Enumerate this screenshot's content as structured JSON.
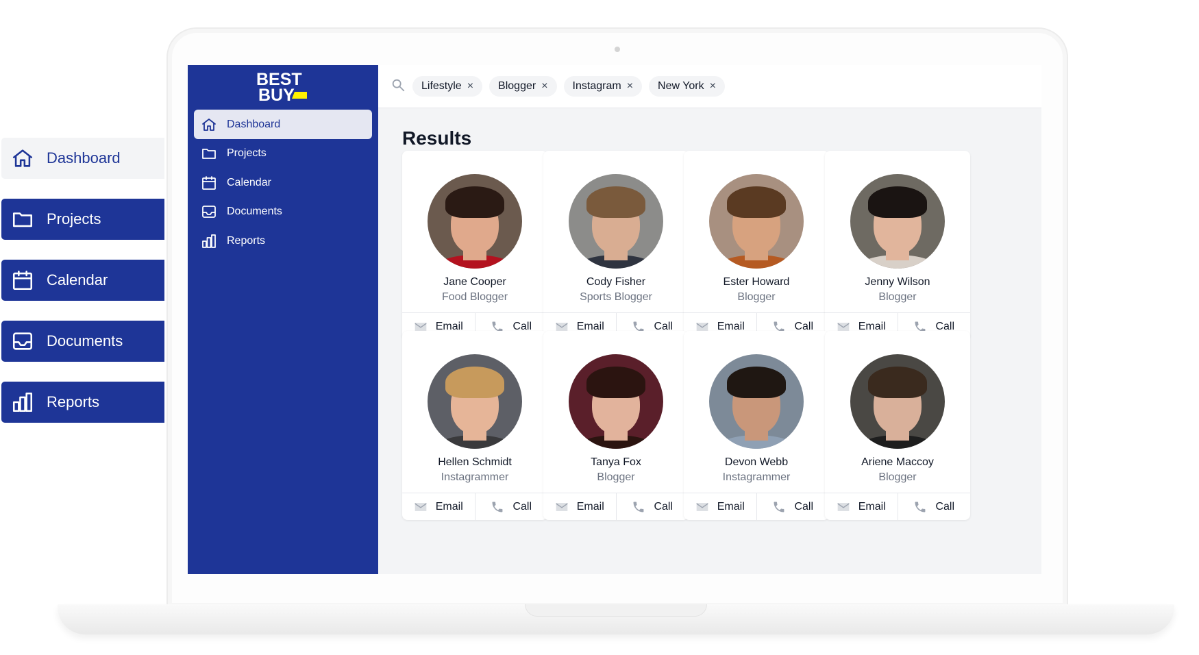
{
  "float_nav": [
    {
      "label": "Dashboard",
      "icon": "home-icon",
      "active": true
    },
    {
      "label": "Projects",
      "icon": "folder-icon",
      "active": false
    },
    {
      "label": "Calendar",
      "icon": "calendar-icon",
      "active": false
    },
    {
      "label": "Documents",
      "icon": "inbox-icon",
      "active": false
    },
    {
      "label": "Reports",
      "icon": "chart-bar-icon",
      "active": false
    }
  ],
  "brand": {
    "line1": "BEST",
    "line2": "BUY",
    "primary_color": "#1e3597",
    "tag_color": "#fff200"
  },
  "sidebar": {
    "items": [
      {
        "label": "Dashboard",
        "icon": "home-icon",
        "active": true
      },
      {
        "label": "Projects",
        "icon": "folder-icon",
        "active": false
      },
      {
        "label": "Calendar",
        "icon": "calendar-icon",
        "active": false
      },
      {
        "label": "Documents",
        "icon": "inbox-icon",
        "active": false
      },
      {
        "label": "Reports",
        "icon": "chart-bar-icon",
        "active": false
      }
    ]
  },
  "search": {
    "icon": "search-icon",
    "chips": [
      {
        "label": "Lifestyle",
        "remove": "×"
      },
      {
        "label": "Blogger",
        "remove": "×"
      },
      {
        "label": "Instagram",
        "remove": "×"
      },
      {
        "label": "New York",
        "remove": "×"
      }
    ]
  },
  "results": {
    "title": "Results",
    "email_label": "Email",
    "call_label": "Call",
    "people": [
      {
        "name": "Jane Cooper",
        "role": "Food Blogger",
        "bg": "#6b5a4e",
        "skin": "#e0a98c",
        "hair": "#2a1a14",
        "shirt": "#b3121f"
      },
      {
        "name": "Cody Fisher",
        "role": "Sports Blogger",
        "bg": "#8c8c8a",
        "skin": "#d9ad92",
        "hair": "#7a5a3c",
        "shirt": "#2f3440"
      },
      {
        "name": "Ester Howard",
        "role": "Blogger",
        "bg": "#a89080",
        "skin": "#d7a27f",
        "hair": "#5a3a22",
        "shirt": "#b55a22"
      },
      {
        "name": "Jenny Wilson",
        "role": "Blogger",
        "bg": "#6e6a62",
        "skin": "#e1b59c",
        "hair": "#1a1412",
        "shirt": "#d8d0c8"
      },
      {
        "name": "Hellen Schmidt",
        "role": "Instagrammer",
        "bg": "#5d5f66",
        "skin": "#e6b598",
        "hair": "#c79a5c",
        "shirt": "#3a3a3c"
      },
      {
        "name": "Tanya Fox",
        "role": "Blogger",
        "bg": "#5a1f2a",
        "skin": "#e2b39c",
        "hair": "#2b1410",
        "shirt": "#2b1410"
      },
      {
        "name": "Devon Webb",
        "role": "Instagrammer",
        "bg": "#7d8a98",
        "skin": "#c9977a",
        "hair": "#1f1712",
        "shirt": "#8fa0b4"
      },
      {
        "name": "Ariene Maccoy",
        "role": "Blogger",
        "bg": "#4a4844",
        "skin": "#d9b09a",
        "hair": "#3a2a1e",
        "shirt": "#1e1e1e"
      }
    ]
  }
}
